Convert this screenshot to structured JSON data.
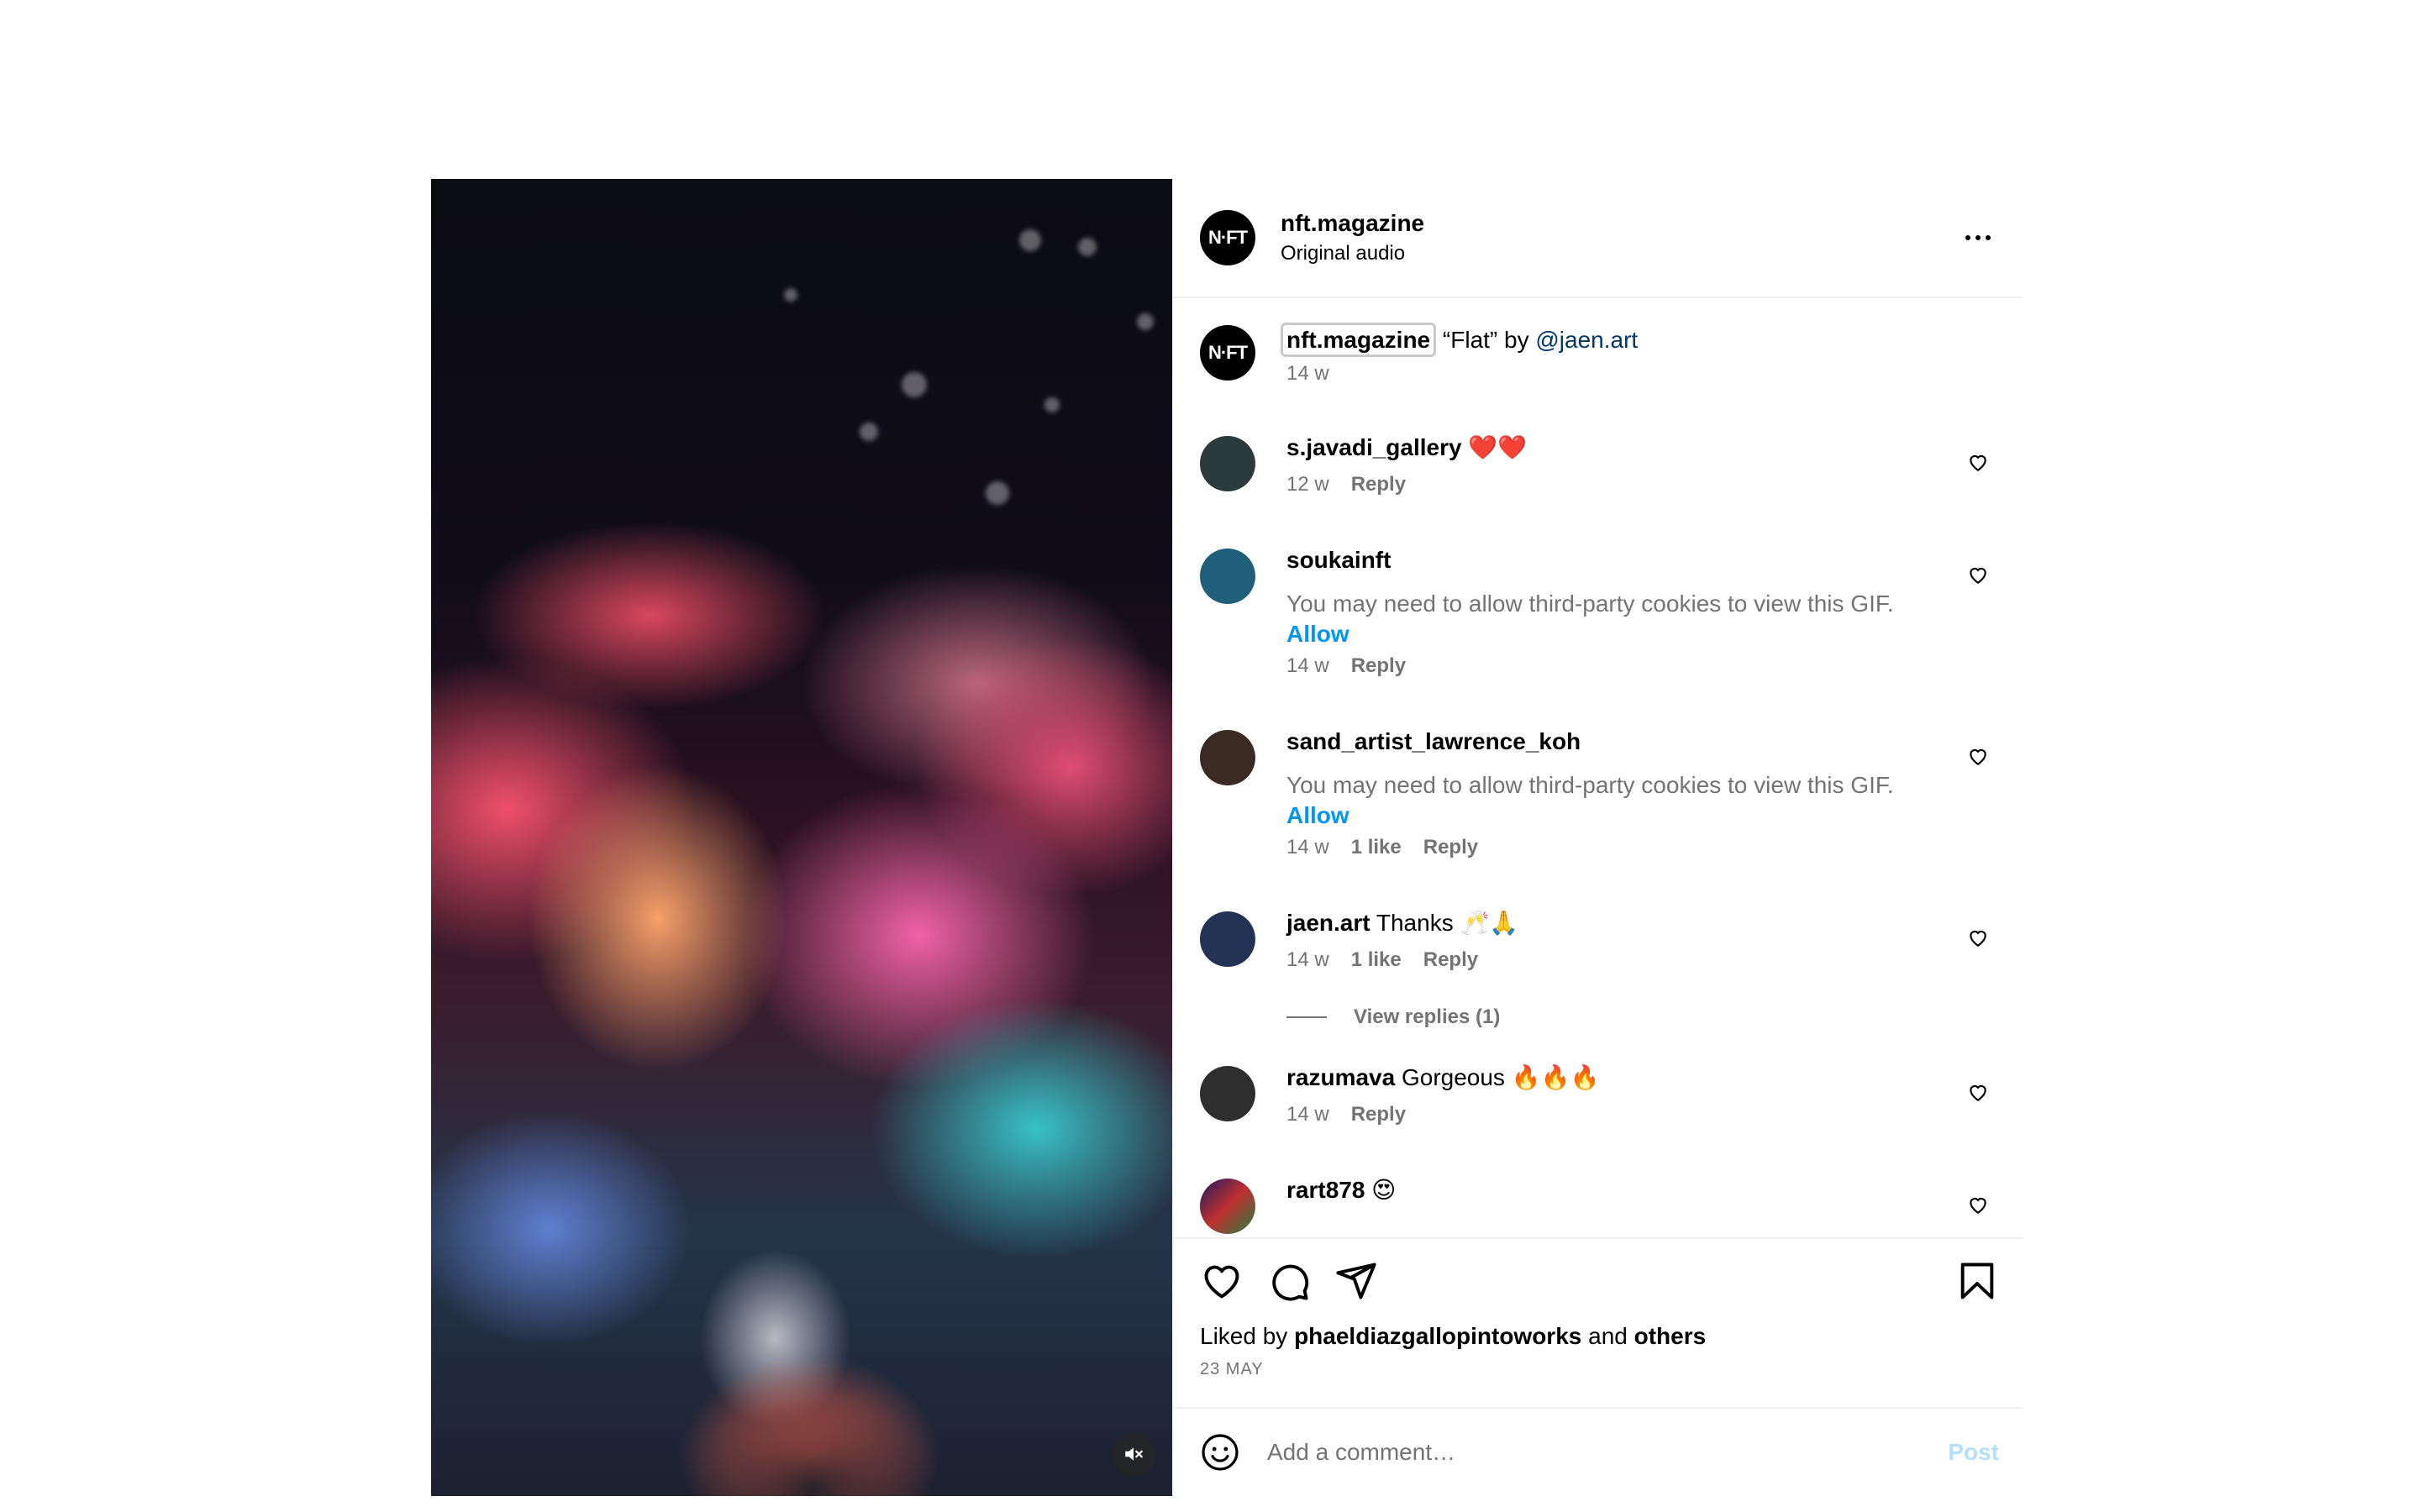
{
  "post": {
    "username": "nft.magazine",
    "audio": "Original audio",
    "avatar_text": "N·FT"
  },
  "caption": {
    "username": "nft.magazine",
    "text": " “Flat” by ",
    "mention": "@jaen.art",
    "time": "14 w"
  },
  "comments": [
    {
      "username": "s.javadi_gallery",
      "text": " ❤️❤️",
      "time": "12 w",
      "likes": "",
      "reply": "Reply",
      "avatar_color": "#2b3a3a"
    },
    {
      "username": "soukainft",
      "text": "",
      "gif_notice": "You may need to allow third-party cookies to view this GIF.",
      "allow": "Allow",
      "time": "14 w",
      "likes": "",
      "reply": "Reply",
      "avatar_color": "#1f5f7a"
    },
    {
      "username": "sand_artist_lawrence_koh",
      "text": "",
      "gif_notice": "You may need to allow third-party cookies to view this GIF.",
      "allow": "Allow",
      "time": "14 w",
      "likes": "1 like",
      "reply": "Reply",
      "avatar_color": "#3a2a22"
    },
    {
      "username": "jaen.art",
      "text": " Thanks 🥂🙏",
      "time": "14 w",
      "likes": "1 like",
      "reply": "Reply",
      "avatar_color": "#223355"
    },
    {
      "username": "razumava",
      "text": " Gorgeous 🔥🔥🔥",
      "time": "14 w",
      "likes": "",
      "reply": "Reply",
      "avatar_color": "#2e2e2e"
    },
    {
      "username": "rart878",
      "text": " 😍",
      "time": "",
      "likes": "",
      "reply": "",
      "avatar_color": "#1a1a60"
    }
  ],
  "view_replies": "View replies (1)",
  "liked": {
    "prefix": "Liked by ",
    "user": "phaeldiazgallopintoworks",
    "middle": " and ",
    "others": "others"
  },
  "date": "23 MAY",
  "add_comment": {
    "placeholder": "Add a comment…",
    "post_label": "Post"
  },
  "colors": {
    "accent": "#0095f6",
    "muted": "#737373",
    "mention": "#00376b",
    "post_disabled": "#b2dffc"
  },
  "icons": [
    "more-icon",
    "heart-icon",
    "comment-icon",
    "share-icon",
    "bookmark-icon",
    "emoji-icon",
    "mute-icon"
  ]
}
